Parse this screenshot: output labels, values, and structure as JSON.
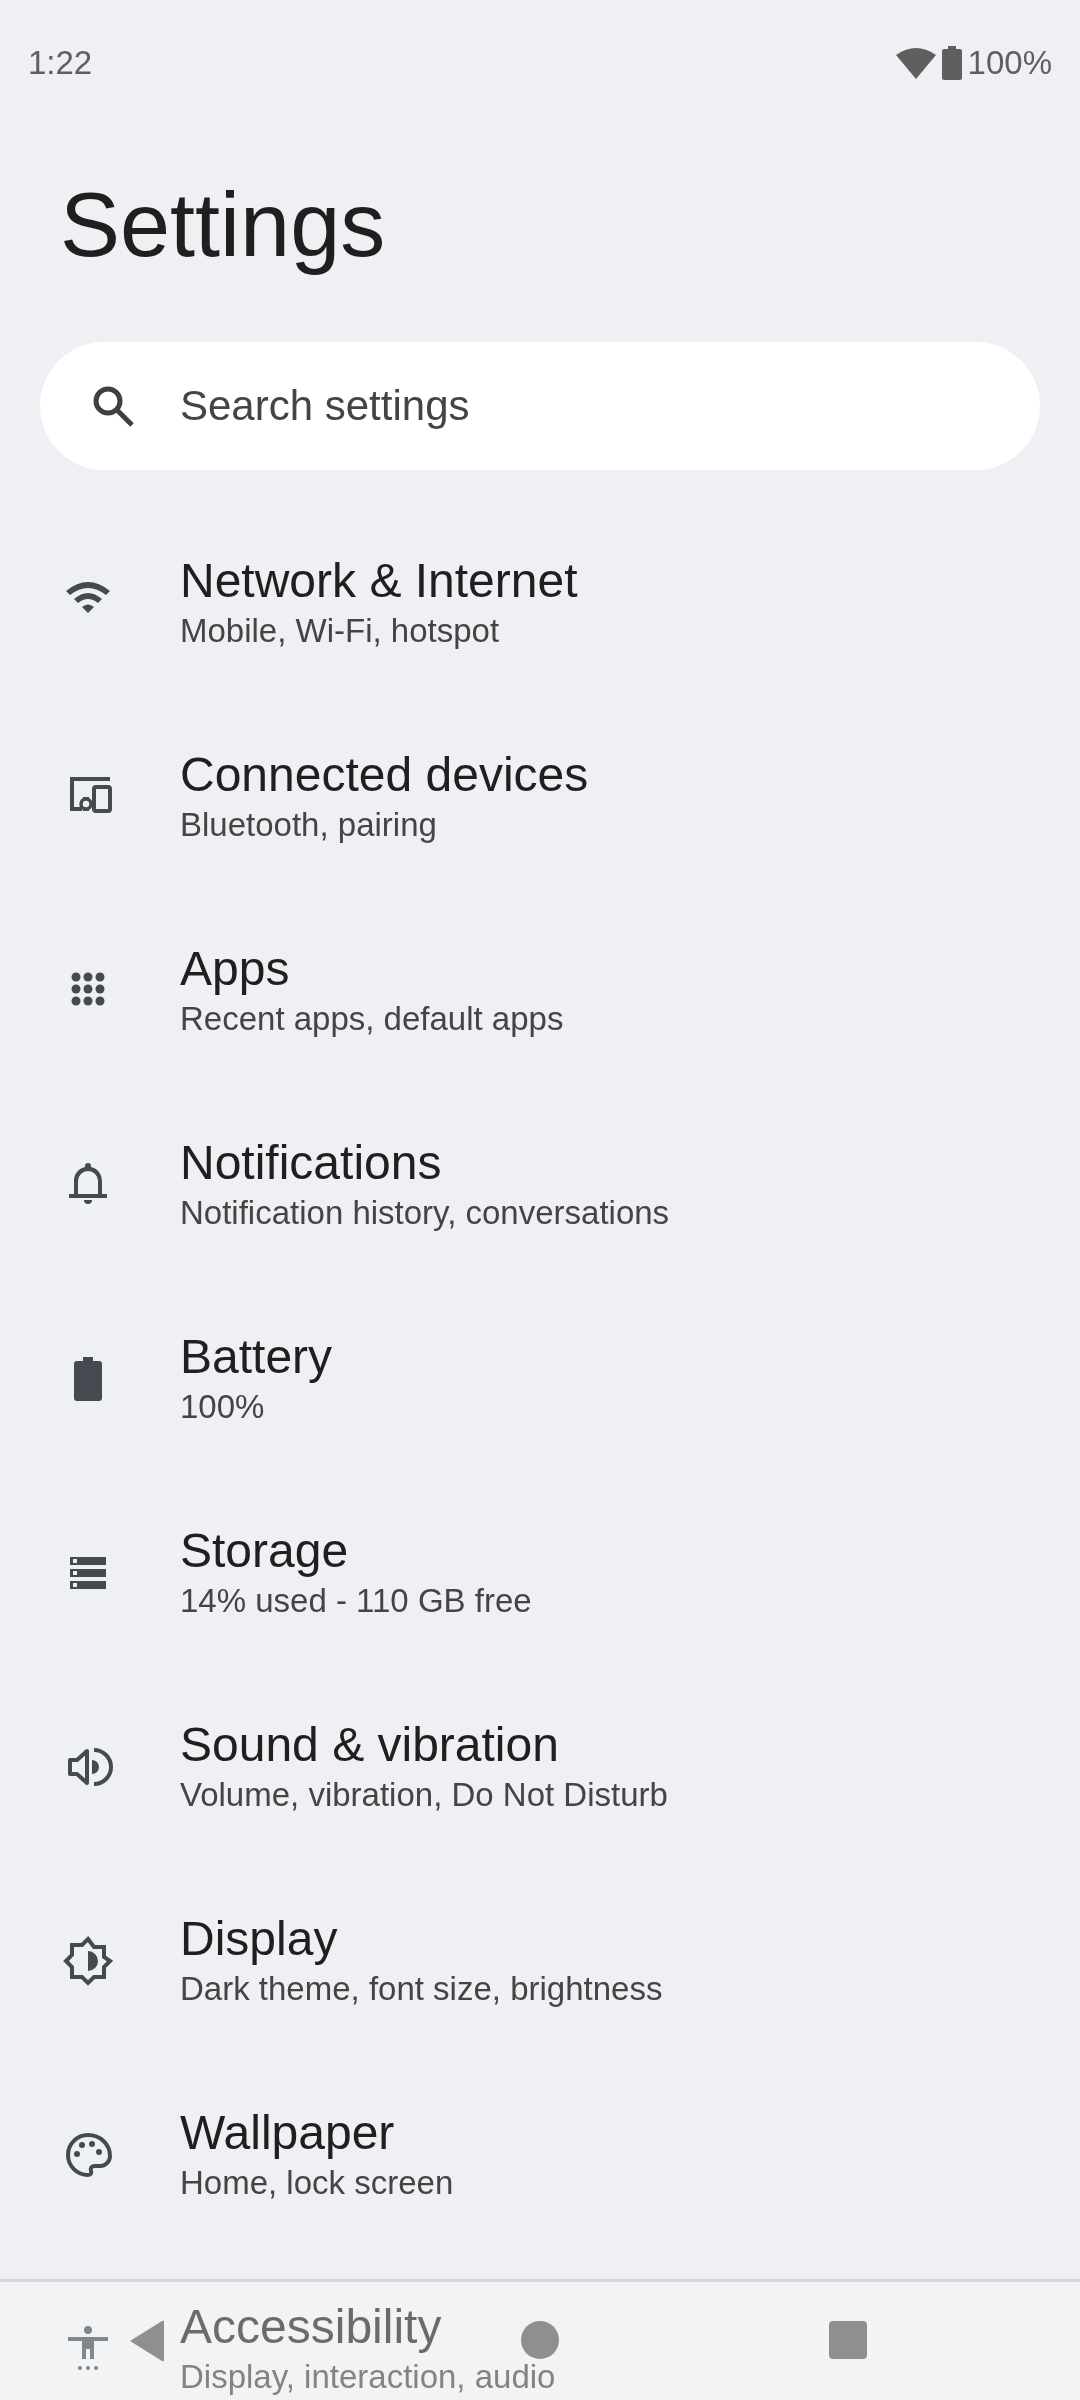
{
  "status_bar": {
    "time": "1:22",
    "battery": "100%"
  },
  "title": "Settings",
  "search": {
    "placeholder": "Search settings"
  },
  "items": [
    {
      "title": "Network & Internet",
      "subtitle": "Mobile, Wi-Fi, hotspot"
    },
    {
      "title": "Connected devices",
      "subtitle": "Bluetooth, pairing"
    },
    {
      "title": "Apps",
      "subtitle": "Recent apps, default apps"
    },
    {
      "title": "Notifications",
      "subtitle": "Notification history, conversations"
    },
    {
      "title": "Battery",
      "subtitle": "100%"
    },
    {
      "title": "Storage",
      "subtitle": "14% used - 110 GB free"
    },
    {
      "title": "Sound & vibration",
      "subtitle": "Volume, vibration, Do Not Disturb"
    },
    {
      "title": "Display",
      "subtitle": "Dark theme, font size, brightness"
    },
    {
      "title": "Wallpaper",
      "subtitle": "Home, lock screen"
    },
    {
      "title": "Accessibility",
      "subtitle": "Display, interaction, audio"
    }
  ]
}
